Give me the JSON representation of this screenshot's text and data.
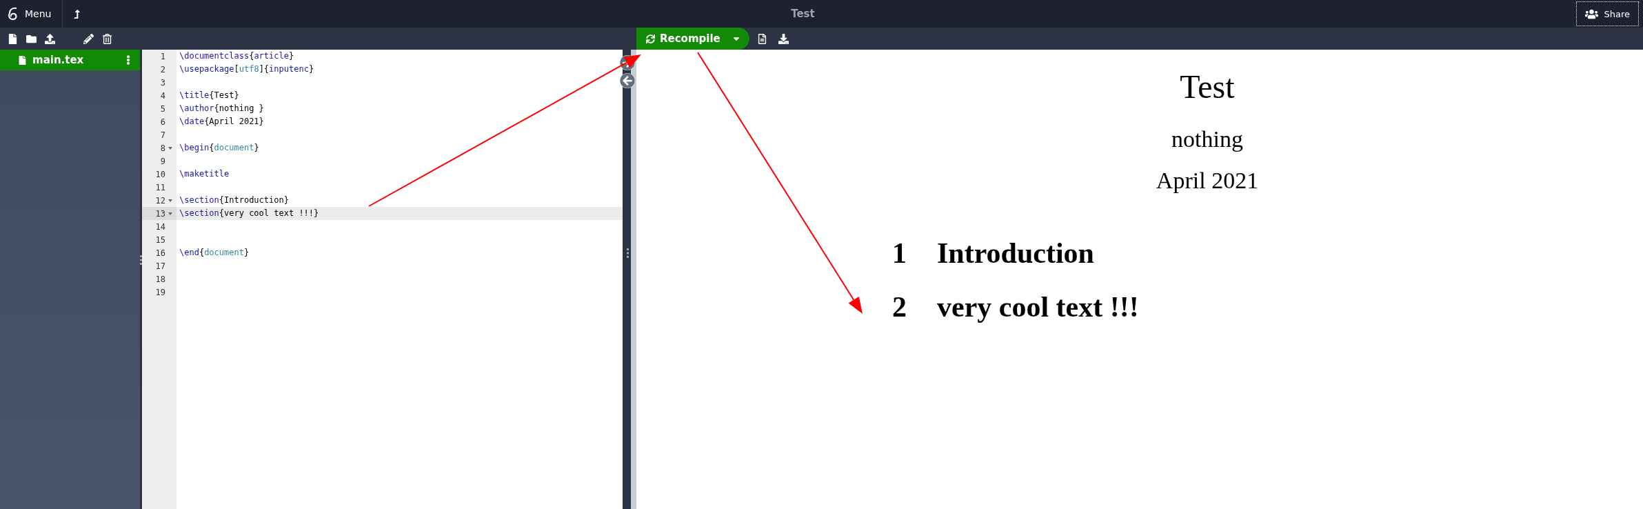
{
  "top_bar": {
    "menu_label": "Menu",
    "title": "Test",
    "share_label": "Share"
  },
  "file_tree": {
    "files": [
      {
        "name": "main.tex",
        "selected": true
      }
    ]
  },
  "compile": {
    "label": "Recompile"
  },
  "editor": {
    "lines": [
      {
        "number": "1",
        "foldable": false,
        "active": false,
        "tokens": [
          {
            "kind": "command",
            "text": "\\documentclass"
          },
          {
            "kind": "text",
            "text": "{"
          },
          {
            "kind": "command",
            "text": "article"
          },
          {
            "kind": "text",
            "text": "}"
          }
        ]
      },
      {
        "number": "2",
        "foldable": false,
        "active": false,
        "tokens": [
          {
            "kind": "command",
            "text": "\\usepackage"
          },
          {
            "kind": "text",
            "text": "["
          },
          {
            "kind": "option",
            "text": "utf8"
          },
          {
            "kind": "text",
            "text": "]{"
          },
          {
            "kind": "command",
            "text": "inputenc"
          },
          {
            "kind": "text",
            "text": "}"
          }
        ]
      },
      {
        "number": "3",
        "foldable": false,
        "active": false
      },
      {
        "number": "4",
        "foldable": false,
        "active": false,
        "tokens": [
          {
            "kind": "command",
            "text": "\\title"
          },
          {
            "kind": "text",
            "text": "{Test}"
          }
        ]
      },
      {
        "number": "5",
        "foldable": false,
        "active": false,
        "tokens": [
          {
            "kind": "command",
            "text": "\\author"
          },
          {
            "kind": "text",
            "text": "{nothing }"
          }
        ]
      },
      {
        "number": "6",
        "foldable": false,
        "active": false,
        "tokens": [
          {
            "kind": "command",
            "text": "\\date"
          },
          {
            "kind": "text",
            "text": "{April 2021}"
          }
        ]
      },
      {
        "number": "7",
        "foldable": false,
        "active": false
      },
      {
        "number": "8",
        "foldable": true,
        "active": false,
        "tokens": [
          {
            "kind": "command",
            "text": "\\begin"
          },
          {
            "kind": "text",
            "text": "{"
          },
          {
            "kind": "option",
            "text": "document"
          },
          {
            "kind": "text",
            "text": "}"
          }
        ]
      },
      {
        "number": "9",
        "foldable": false,
        "active": false
      },
      {
        "number": "10",
        "foldable": false,
        "active": false,
        "tokens": [
          {
            "kind": "command",
            "text": "\\maketitle"
          }
        ]
      },
      {
        "number": "11",
        "foldable": false,
        "active": false
      },
      {
        "number": "12",
        "foldable": true,
        "active": false,
        "tokens": [
          {
            "kind": "command",
            "text": "\\section"
          },
          {
            "kind": "text",
            "text": "{Introduction}"
          }
        ]
      },
      {
        "number": "13",
        "foldable": true,
        "active": true,
        "tokens": [
          {
            "kind": "command",
            "text": "\\section"
          },
          {
            "kind": "text",
            "text": "{very cool text !!!}"
          }
        ]
      },
      {
        "number": "14",
        "foldable": false,
        "active": false
      },
      {
        "number": "15",
        "foldable": false,
        "active": false
      },
      {
        "number": "16",
        "foldable": false,
        "active": false,
        "tokens": [
          {
            "kind": "command",
            "text": "\\end"
          },
          {
            "kind": "text",
            "text": "{"
          },
          {
            "kind": "option",
            "text": "document"
          },
          {
            "kind": "text",
            "text": "}"
          }
        ]
      },
      {
        "number": "17",
        "foldable": false,
        "active": false
      },
      {
        "number": "18",
        "foldable": false,
        "active": false
      },
      {
        "number": "19",
        "foldable": false,
        "active": false
      }
    ]
  },
  "pdf": {
    "title": "Test",
    "author": "nothing",
    "date": "April 2021",
    "sections": [
      {
        "number": "1",
        "title": "Introduction"
      },
      {
        "number": "2",
        "title": "very cool text !!!"
      }
    ]
  }
}
